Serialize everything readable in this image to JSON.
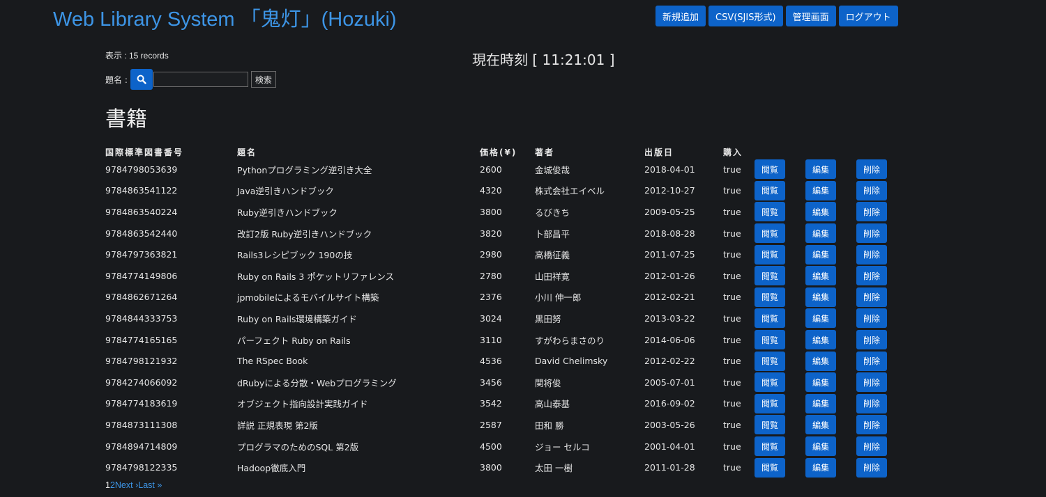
{
  "header": {
    "app_title": "Web Library System 「鬼灯」(Hozuki)",
    "nav": [
      "新規追加",
      "CSV(SJIS形式)",
      "管理画面",
      "ログアウト"
    ]
  },
  "summary": {
    "record_count": "表示 : 15 records"
  },
  "clock": {
    "text": "現在時刻 [ 11:21:01 ]"
  },
  "search": {
    "label": "題名 :",
    "value": "",
    "submit_label": "検索",
    "icon": "search-icon"
  },
  "section_title": "書籍",
  "table": {
    "headers": [
      "国際標準図書番号",
      "題名",
      "価格(¥)",
      "著者",
      "出版日",
      "購入"
    ],
    "action_labels": {
      "view": "閲覧",
      "edit": "編集",
      "delete": "削除"
    },
    "rows": [
      [
        "9784798053639",
        "Pythonプログラミング逆引き大全",
        "2600",
        "金城俊哉",
        "2018-04-01",
        "true"
      ],
      [
        "9784863541122",
        "Java逆引きハンドブック",
        "4320",
        "株式会社エイベル",
        "2012-10-27",
        "true"
      ],
      [
        "9784863540224",
        "Ruby逆引きハンドブック",
        "3800",
        "るびきち",
        "2009-05-25",
        "true"
      ],
      [
        "9784863542440",
        "改訂2版 Ruby逆引きハンドブック",
        "3820",
        "卜部昌平",
        "2018-08-28",
        "true"
      ],
      [
        "9784797363821",
        "Rails3レシピブック 190の技",
        "2980",
        "高橋征義",
        "2011-07-25",
        "true"
      ],
      [
        "9784774149806",
        "Ruby on Rails 3 ポケットリファレンス",
        "2780",
        "山田祥寛",
        "2012-01-26",
        "true"
      ],
      [
        "9784862671264",
        "jpmobileによるモバイルサイト構築",
        "2376",
        "小川 伸一郎",
        "2012-02-21",
        "true"
      ],
      [
        "9784844333753",
        "Ruby on Rails環境構築ガイド",
        "3024",
        "黒田努",
        "2013-03-22",
        "true"
      ],
      [
        "9784774165165",
        "パーフェクト Ruby on Rails",
        "3110",
        "すがわらまさのり",
        "2014-06-06",
        "true"
      ],
      [
        "9784798121932",
        "The RSpec Book",
        "4536",
        "David Chelimsky",
        "2012-02-22",
        "true"
      ],
      [
        "9784274066092",
        "dRubyによる分散・Webプログラミング",
        "3456",
        "関将俊",
        "2005-07-01",
        "true"
      ],
      [
        "9784774183619",
        "オブジェクト指向設計実践ガイド",
        "3542",
        "高山泰基",
        "2016-09-02",
        "true"
      ],
      [
        "9784873111308",
        "詳説 正規表現 第2版",
        "2587",
        "田和 勝",
        "2003-05-26",
        "true"
      ],
      [
        "9784894714809",
        "プログラマのためのSQL 第2版",
        "4500",
        "ジョー セルコ",
        "2001-04-01",
        "true"
      ],
      [
        "9784798122335",
        "Hadoop徹底入門",
        "3800",
        "太田 一樹",
        "2011-01-28",
        "true"
      ]
    ]
  },
  "pagination": {
    "current": "1",
    "page2": "2",
    "next": "Next ›",
    "last": "Last »"
  },
  "colors": {
    "background": "#181a1d",
    "accent": "#0d63c9",
    "link": "#3d95e6"
  }
}
